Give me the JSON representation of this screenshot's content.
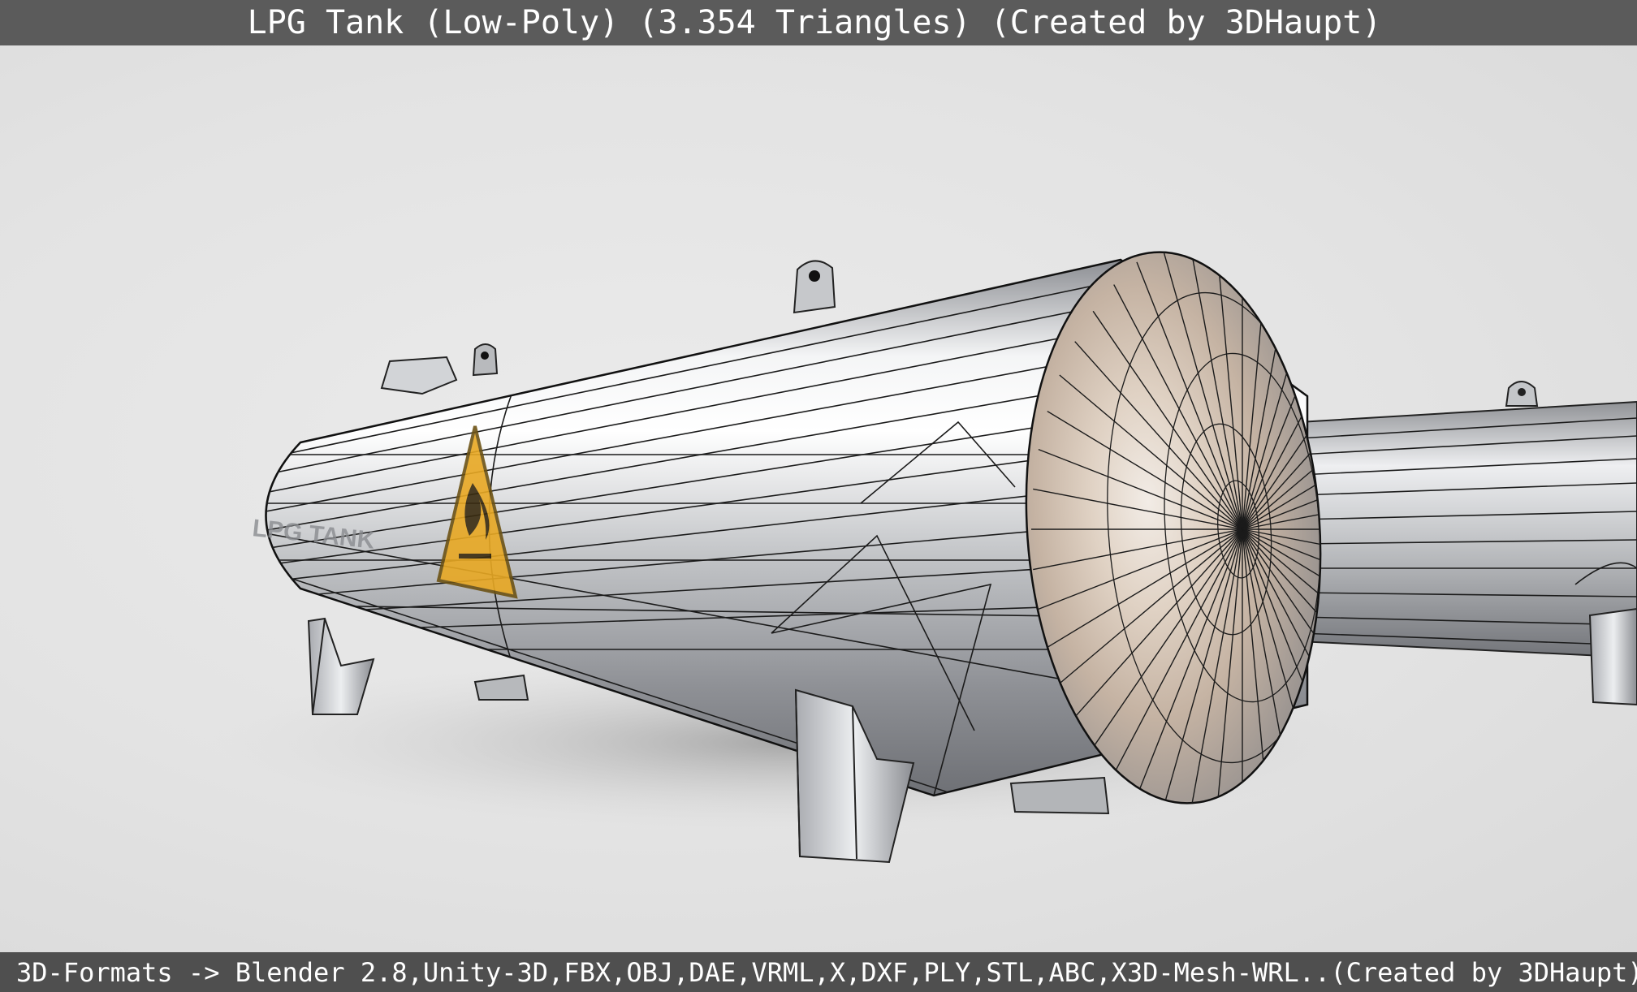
{
  "header": {
    "title": "LPG Tank (Low-Poly) (3.354 Triangles) (Created by 3DHaupt)"
  },
  "viewport": {
    "model": "lpg-tank-low-poly",
    "tank_label": "LPG TANK",
    "warning_symbol": "flame-warning-icon"
  },
  "footer": {
    "formats_text": "3D-Formats -> Blender 2.8,Unity-3D,FBX,OBJ,DAE,VRML,X,DXF,PLY,STL,ABC,X3D-Mesh-WRL..(Created by 3DHaupt)"
  },
  "colors": {
    "title_bar": "#5b5b5b",
    "footer_bar": "#4f4f4f",
    "background": "#e2e2e2",
    "tank_metal": "#c9cacc",
    "wireframe": "#1b1b1b",
    "warning_yellow": "#e8a823"
  }
}
